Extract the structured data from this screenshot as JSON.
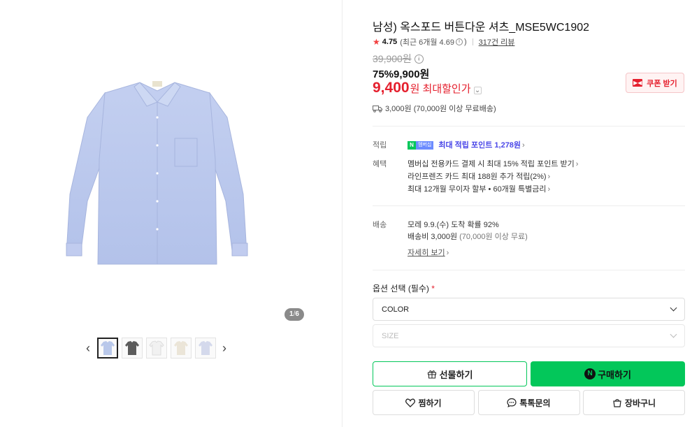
{
  "gallery": {
    "counter_current": "1",
    "counter_total": "6",
    "thumb_colors": [
      "#b9c8ea",
      "#5c5c5c",
      "#f1f1f1",
      "#ebe5d8",
      "#d4d9ec"
    ]
  },
  "product": {
    "title": "남성) 옥스포드 버튼다운 셔츠_MSE5WC1902",
    "rating": "4.75",
    "rating_recent": "(최근 6개월 4.69",
    "rating_recent_close": ")",
    "reviews": "317건 리뷰",
    "original_price": "39,900원",
    "sale_price": "75%9,900원",
    "best_price_num": "9,400",
    "best_price_text": "원 최대할인가",
    "coupon_label": "쿠폰 받기",
    "shipping_summary": "3,000원 (70,000원 이상 무료배송)"
  },
  "benefits": {
    "points_label": "적립",
    "points_badge_n": "N",
    "points_badge_plus": "멤버십",
    "points_text": "최대 적립 포인트 1,278원",
    "benefit_label": "혜택",
    "benefit_lines": [
      "멤버십 전용카드 결제 시 최대 15% 적립 포인트 받기",
      "라인프렌즈 카드 최대 188원 추가 적립(2%)",
      "최대 12개월 무이자 할부 • 60개월 특별금리"
    ]
  },
  "delivery": {
    "label": "배송",
    "arrival": "모레 9.9.(수) 도착 확률 92%",
    "fee": "배송비 3,000원",
    "fee_note": "(70,000원 이상 무료)",
    "detail_link": "자세히 보기"
  },
  "options": {
    "label": "옵션 선택 (필수)",
    "required_mark": "*",
    "color": "COLOR",
    "size": "SIZE"
  },
  "actions": {
    "gift": "선물하기",
    "buy": "구매하기",
    "wish": "찜하기",
    "talk": "톡톡문의",
    "cart": "장바구니"
  },
  "colors": {
    "accent_red": "#e5202e",
    "naver_green": "#03c75a",
    "points_purple": "#4a47e8"
  }
}
